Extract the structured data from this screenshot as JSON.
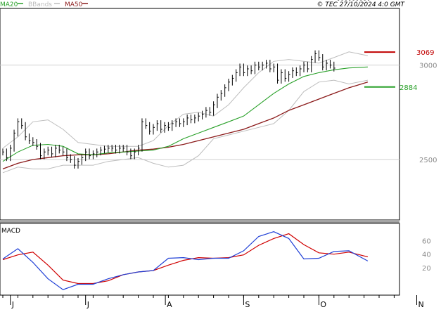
{
  "header": {
    "legend": [
      {
        "label": "MA20",
        "color": "#2aa12a"
      },
      {
        "label": "BBands",
        "color": "#bdbdbd"
      },
      {
        "label": "MA50",
        "color": "#8b1a1a"
      }
    ],
    "copyright": "© TEC 27/10/2024 4:0 GMT"
  },
  "price_panel": {
    "y_ticks": [
      3000,
      2500
    ],
    "y_tick_labels": [
      "3000",
      "2500"
    ],
    "range": [
      2180,
      3300
    ],
    "annotations": [
      {
        "label": "3069",
        "value": 3069,
        "color": "#c00000"
      },
      {
        "label": "2884",
        "value": 2884,
        "color": "#2aa12a"
      }
    ]
  },
  "macd_panel": {
    "title": "MACD",
    "y_ticks": [
      60,
      40,
      20
    ],
    "y_tick_labels": [
      "60",
      "40",
      "20"
    ],
    "range": [
      -20,
      85
    ],
    "macd_color": "#1f3fd6",
    "signal_color": "#d00000"
  },
  "x_axis": {
    "labels": [
      "J",
      "J",
      "A",
      "S",
      "O",
      "N"
    ],
    "positions": [
      0.5,
      5.5,
      10.8,
      16,
      21,
      27.5
    ],
    "week_count": 28
  },
  "chart_data": [
    {
      "type": "ohlc",
      "name": "price",
      "x_weeks": [
        0,
        0.25,
        0.5,
        0.75,
        1,
        1.25,
        1.5,
        1.75,
        2,
        2.25,
        2.5,
        2.75,
        3,
        3.25,
        3.5,
        3.75,
        4,
        4.25,
        4.5,
        4.75,
        5,
        5.25,
        5.5,
        5.75,
        6,
        6.25,
        6.5,
        6.75,
        7,
        7.25,
        7.5,
        7.75,
        8,
        8.25,
        8.5,
        8.75,
        9,
        9.25,
        9.5,
        9.75,
        10,
        10.25,
        10.5,
        10.75,
        11,
        11.25,
        11.5,
        11.75,
        12,
        12.25,
        12.5,
        12.75,
        13,
        13.25,
        13.5,
        13.75,
        14,
        14.25,
        14.5,
        14.75,
        15,
        15.25,
        15.5,
        15.75,
        16,
        16.25,
        16.5,
        16.75,
        17,
        17.25,
        17.5,
        17.75,
        18,
        18.25,
        18.5,
        18.75,
        19,
        19.25,
        19.5,
        19.75,
        20,
        20.25,
        20.5,
        20.75,
        21,
        21.25,
        21.5,
        21.75,
        22,
        22.25,
        22.5,
        22.75,
        23,
        23.25,
        23.5,
        23.75,
        24,
        24.25
      ],
      "close": [
        2540,
        2510,
        2560,
        2640,
        2700,
        2680,
        2620,
        2600,
        2590,
        2570,
        2520,
        2540,
        2550,
        2530,
        2560,
        2550,
        2540,
        2510,
        2500,
        2470,
        2490,
        2510,
        2540,
        2520,
        2530,
        2540,
        2550,
        2555,
        2560,
        2560,
        2550,
        2560,
        2560,
        2540,
        2520,
        2540,
        2560,
        2700,
        2680,
        2650,
        2670,
        2690,
        2660,
        2680,
        2670,
        2690,
        2700,
        2690,
        2700,
        2720,
        2710,
        2720,
        2730,
        2740,
        2760,
        2750,
        2790,
        2830,
        2850,
        2880,
        2910,
        2930,
        2960,
        2990,
        2960,
        2980,
        2970,
        3000,
        2990,
        3000,
        3010,
        2980,
        2990,
        2920,
        2960,
        2930,
        2950,
        2970,
        2960,
        2980,
        3000,
        2980,
        3030,
        3060,
        3040,
        2990,
        3010,
        3000,
        2984
      ]
    },
    {
      "type": "line",
      "name": "MA20",
      "x_weeks": [
        0,
        1,
        2,
        3,
        4,
        5,
        6,
        7,
        8,
        9,
        10,
        11,
        12,
        13,
        14,
        15,
        16,
        17,
        18,
        19,
        20,
        21,
        22,
        23,
        24.25
      ],
      "values": [
        2490,
        2540,
        2575,
        2580,
        2570,
        2530,
        2525,
        2535,
        2540,
        2545,
        2550,
        2570,
        2610,
        2640,
        2670,
        2700,
        2730,
        2790,
        2850,
        2900,
        2940,
        2960,
        2975,
        2985,
        2990
      ]
    },
    {
      "type": "line",
      "name": "MA50",
      "x_weeks": [
        0,
        1,
        2,
        3,
        4,
        5,
        6,
        7,
        8,
        9,
        10,
        11,
        12,
        13,
        14,
        15,
        16,
        17,
        18,
        19,
        20,
        21,
        22,
        23,
        24.25
      ],
      "values": [
        2450,
        2480,
        2500,
        2510,
        2520,
        2525,
        2525,
        2530,
        2540,
        2550,
        2555,
        2565,
        2580,
        2600,
        2620,
        2640,
        2660,
        2690,
        2720,
        2760,
        2790,
        2820,
        2850,
        2880,
        2910
      ]
    },
    {
      "type": "line",
      "name": "BBands upper",
      "x_weeks": [
        0,
        1,
        2,
        3,
        4,
        5,
        6,
        7,
        8,
        9,
        10,
        11,
        12,
        13,
        14,
        15,
        16,
        17,
        18,
        19,
        20,
        21,
        22,
        23,
        24.25
      ],
      "values": [
        2560,
        2620,
        2700,
        2710,
        2660,
        2590,
        2580,
        2570,
        2570,
        2570,
        2600,
        2680,
        2740,
        2750,
        2730,
        2790,
        2880,
        2960,
        3020,
        3030,
        3020,
        3010,
        3040,
        3070,
        3050
      ]
    },
    {
      "type": "line",
      "name": "BBands lower",
      "x_weeks": [
        0,
        1,
        2,
        3,
        4,
        5,
        6,
        7,
        8,
        9,
        10,
        11,
        12,
        13,
        14,
        15,
        16,
        17,
        18,
        19,
        20,
        21,
        22,
        23,
        24.25
      ],
      "values": [
        2430,
        2460,
        2450,
        2450,
        2470,
        2470,
        2470,
        2490,
        2500,
        2510,
        2480,
        2460,
        2470,
        2520,
        2610,
        2630,
        2650,
        2670,
        2690,
        2760,
        2860,
        2910,
        2920,
        2900,
        2920
      ]
    },
    {
      "type": "line",
      "name": "MACD",
      "x_weeks": [
        0,
        1,
        2,
        3,
        4,
        5,
        6,
        7,
        8,
        9,
        10,
        11,
        12,
        13,
        14,
        15,
        16,
        17,
        18,
        19,
        20,
        21,
        22,
        23,
        24.25
      ],
      "values": [
        33,
        48,
        28,
        4,
        -12,
        -4,
        -4,
        4,
        10,
        14,
        16,
        34,
        35,
        32,
        34,
        34,
        45,
        66,
        73,
        63,
        33,
        34,
        44,
        45,
        30
      ]
    },
    {
      "type": "line",
      "name": "Signal",
      "x_weeks": [
        0,
        1,
        2,
        3,
        4,
        5,
        6,
        7,
        8,
        9,
        10,
        11,
        12,
        13,
        14,
        15,
        16,
        17,
        18,
        19,
        20,
        21,
        22,
        23,
        24.25
      ],
      "values": [
        32,
        39,
        43,
        24,
        2,
        -3,
        -3,
        1,
        10,
        14,
        16,
        24,
        31,
        35,
        34,
        35,
        39,
        53,
        63,
        70,
        54,
        42,
        40,
        43,
        36
      ]
    }
  ]
}
